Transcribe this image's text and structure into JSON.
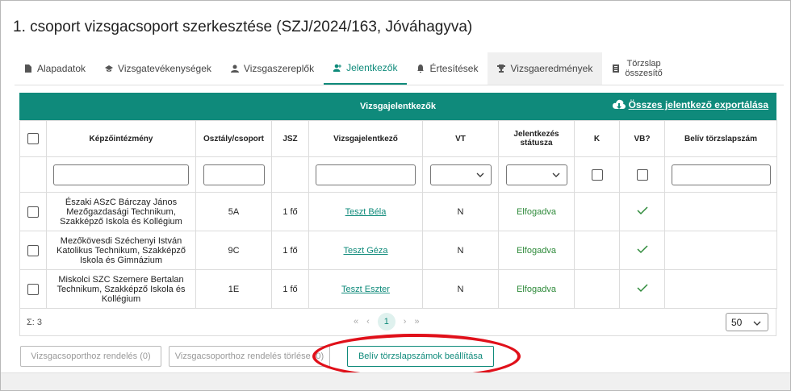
{
  "page_title": "1. csoport vizsgacsoport szerkesztése (SZJ/2024/163, Jóváhagyva)",
  "tabs": [
    {
      "label": "Alapadatok",
      "icon": "document-icon"
    },
    {
      "label": "Vizsgatevékenységek",
      "icon": "graduation-cap-icon"
    },
    {
      "label": "Vizsgaszereplők",
      "icon": "person-icon"
    },
    {
      "label": "Jelentkezők",
      "icon": "user-plus-icon"
    },
    {
      "label": "Értesítések",
      "icon": "bell-icon"
    },
    {
      "label": "Vizsgaeredmények",
      "icon": "trophy-icon"
    },
    {
      "label_line1": "Törzslap",
      "label_line2": "összesítő",
      "icon": "list-icon"
    }
  ],
  "active_tab": "Jelentkezők",
  "grid": {
    "title": "Vizsgajelentkezők",
    "export_label": "Összes jelentkező exportálása",
    "columns": [
      "Képzőintézmény",
      "Osztály/csoport",
      "JSZ",
      "Vizsgajelentkező",
      "VT",
      "Jelentkezés",
      "státusza",
      "K",
      "VB?",
      "Belív törzslapszám"
    ],
    "rows": [
      {
        "school_l1": "Északi ASzC Bárczay János",
        "school_l2": "Mezőgazdasági Technikum,",
        "school_l3": "Szakképző Iskola és Kollégium",
        "class": "5A",
        "jsz": "1 fő",
        "name": "Teszt Béla",
        "vt": "N",
        "status": "Elfogadva"
      },
      {
        "school_l1": "Mezőkövesdi Széchenyi István",
        "school_l2": "Katolikus Technikum, Szakképző",
        "school_l3": "Iskola és Gimnázium",
        "class": "9C",
        "jsz": "1 fő",
        "name": "Teszt Géza",
        "vt": "N",
        "status": "Elfogadva"
      },
      {
        "school_l1": "Miskolci SZC Szemere Bertalan",
        "school_l2": "Technikum, Szakképző Iskola és",
        "school_l3": "Kollégium",
        "class": "1E",
        "jsz": "1 fő",
        "name": "Teszt Eszter",
        "vt": "N",
        "status": "Elfogadva"
      }
    ],
    "sum_label": "Σ: 3",
    "pager": {
      "first": "«",
      "prev": "‹",
      "current": "1",
      "next": "›",
      "last": "»"
    },
    "page_size": "50"
  },
  "buttons": {
    "assign": "Vizsgacsoporthoz rendelés (0)",
    "unassign": "Vizsgacsoporthoz rendelés törlése (0)",
    "set_numbers": "Belív törzslapszámok beállítása"
  },
  "colors": {
    "accent": "#0f8a7b",
    "highlight_ellipse": "#e0101a",
    "status_green": "#2e8a3a"
  }
}
